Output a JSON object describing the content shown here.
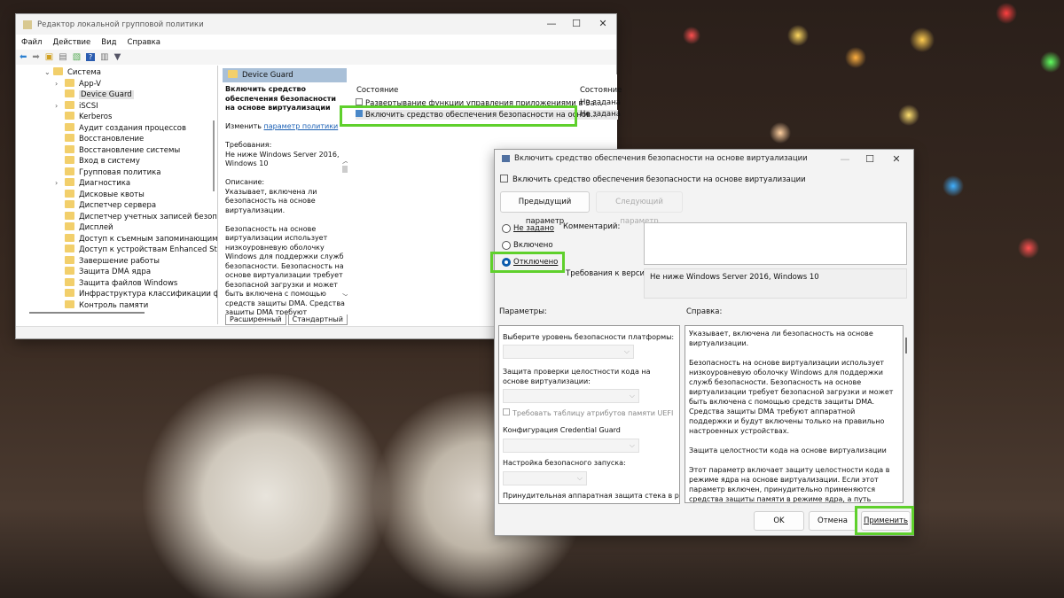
{
  "main_window": {
    "title": "Редактор локальной групповой политики",
    "menu": [
      "Файл",
      "Действие",
      "Вид",
      "Справка"
    ],
    "tree": [
      {
        "label": "Система",
        "expanded": true,
        "level": 0
      },
      {
        "label": "App-V",
        "expandable": true
      },
      {
        "label": "Device Guard",
        "selected": true
      },
      {
        "label": "iSCSI",
        "expandable": true
      },
      {
        "label": "Kerberos"
      },
      {
        "label": "Аудит создания процессов"
      },
      {
        "label": "Восстановление"
      },
      {
        "label": "Восстановление системы"
      },
      {
        "label": "Вход в систему"
      },
      {
        "label": "Групповая политика"
      },
      {
        "label": "Диагностика",
        "expandable": true
      },
      {
        "label": "Дисковые квоты"
      },
      {
        "label": "Диспетчер сервера"
      },
      {
        "label": "Диспетчер учетных записей безопасности"
      },
      {
        "label": "Дисплей"
      },
      {
        "label": "Доступ к съемным запоминающим устройствам"
      },
      {
        "label": "Доступ к устройствам Enhanced Storage"
      },
      {
        "label": "Завершение работы"
      },
      {
        "label": "Защита DMA ядра"
      },
      {
        "label": "Защита файлов Windows"
      },
      {
        "label": "Инфраструктура классификации файлов"
      },
      {
        "label": "Контроль памяти"
      }
    ],
    "folder_header": "Device Guard",
    "desc": {
      "title": "Включить средство обеспечения безопасности на основе виртуализации",
      "edit_prefix": "Изменить",
      "edit_link": "параметр политики",
      "req_label": "Требования:",
      "req_text": "Не ниже Windows Server 2016, Windows 10",
      "desc_label": "Описание:",
      "desc_text": "Указывает, включена ли безопасность на основе виртуализации.",
      "desc_text2": "Безопасность на основе виртуализации использует низкоуровневую оболочку Windows для поддержки служб безопасности. Безопасность на основе виртуализации требует безопасной загрузки и может быть включена с помощью средств защиты DMA. Средства защиты DMA требуют"
    },
    "list": {
      "col1": "Состояние",
      "col2": "Состояние",
      "rows": [
        {
          "name": "Развертывание функции управления приложениями в За...",
          "state": "Не задана"
        },
        {
          "name": "Включить средство обеспечения безопасности на основ...",
          "state": "Не задана"
        }
      ]
    },
    "tabs": [
      "Расширенный",
      "Стандартный"
    ]
  },
  "dialog": {
    "title": "Включить средство обеспечения безопасности на основе виртуализации",
    "subtitle": "Включить средство обеспечения безопасности на основе виртуализации",
    "prev_btn": "Предыдущий параметр",
    "next_btn": "Следующий параметр",
    "radios": [
      {
        "label": "Не задано",
        "checked": false
      },
      {
        "label": "Включено",
        "checked": false
      },
      {
        "label": "Отключено",
        "checked": true
      }
    ],
    "comment_label": "Комментарий:",
    "comment_value": "",
    "version_label": "Требования к версии:",
    "version_value": "Не ниже Windows Server 2016, Windows 10",
    "params_label": "Параметры:",
    "help_label": "Справка:",
    "params": {
      "platform": "Выберите уровень безопасности платформы:",
      "hvci": "Защита проверки целостности кода на основе виртуализации:",
      "uefi": "Требовать таблицу атрибутов памяти UEFI",
      "cg": "Конфигурация Credential Guard",
      "launch": "Настройка безопасного запуска:",
      "stack": "Принудительная аппаратная защита стека в режиме"
    },
    "help": [
      "Указывает, включена ли безопасность на основе виртуализации.",
      "Безопасность на основе виртуализации использует низкоуровневую оболочку Windows для поддержки служб безопасности. Безопасность на основе виртуализации требует безопасной загрузки и может быть включена с помощью средств защиты DMA. Средства защиты DMA требуют аппаратной поддержки и будут включены только на правильно настроенных устройствах.",
      "Защита целостности кода на основе виртуализации",
      "Этот параметр включает защиту целостности кода в режиме ядра на основе виртуализации. Если этот параметр включен, принудительно применяются средства защиты памяти в режиме ядра, а путь проверки целостности кода защищается с помощью безопасности на основе виртуализации."
    ],
    "ok": "OK",
    "cancel": "Отмена",
    "apply": "Применить"
  },
  "colors": {
    "highlight": "#5fd02c",
    "accent": "#0b5cad"
  }
}
